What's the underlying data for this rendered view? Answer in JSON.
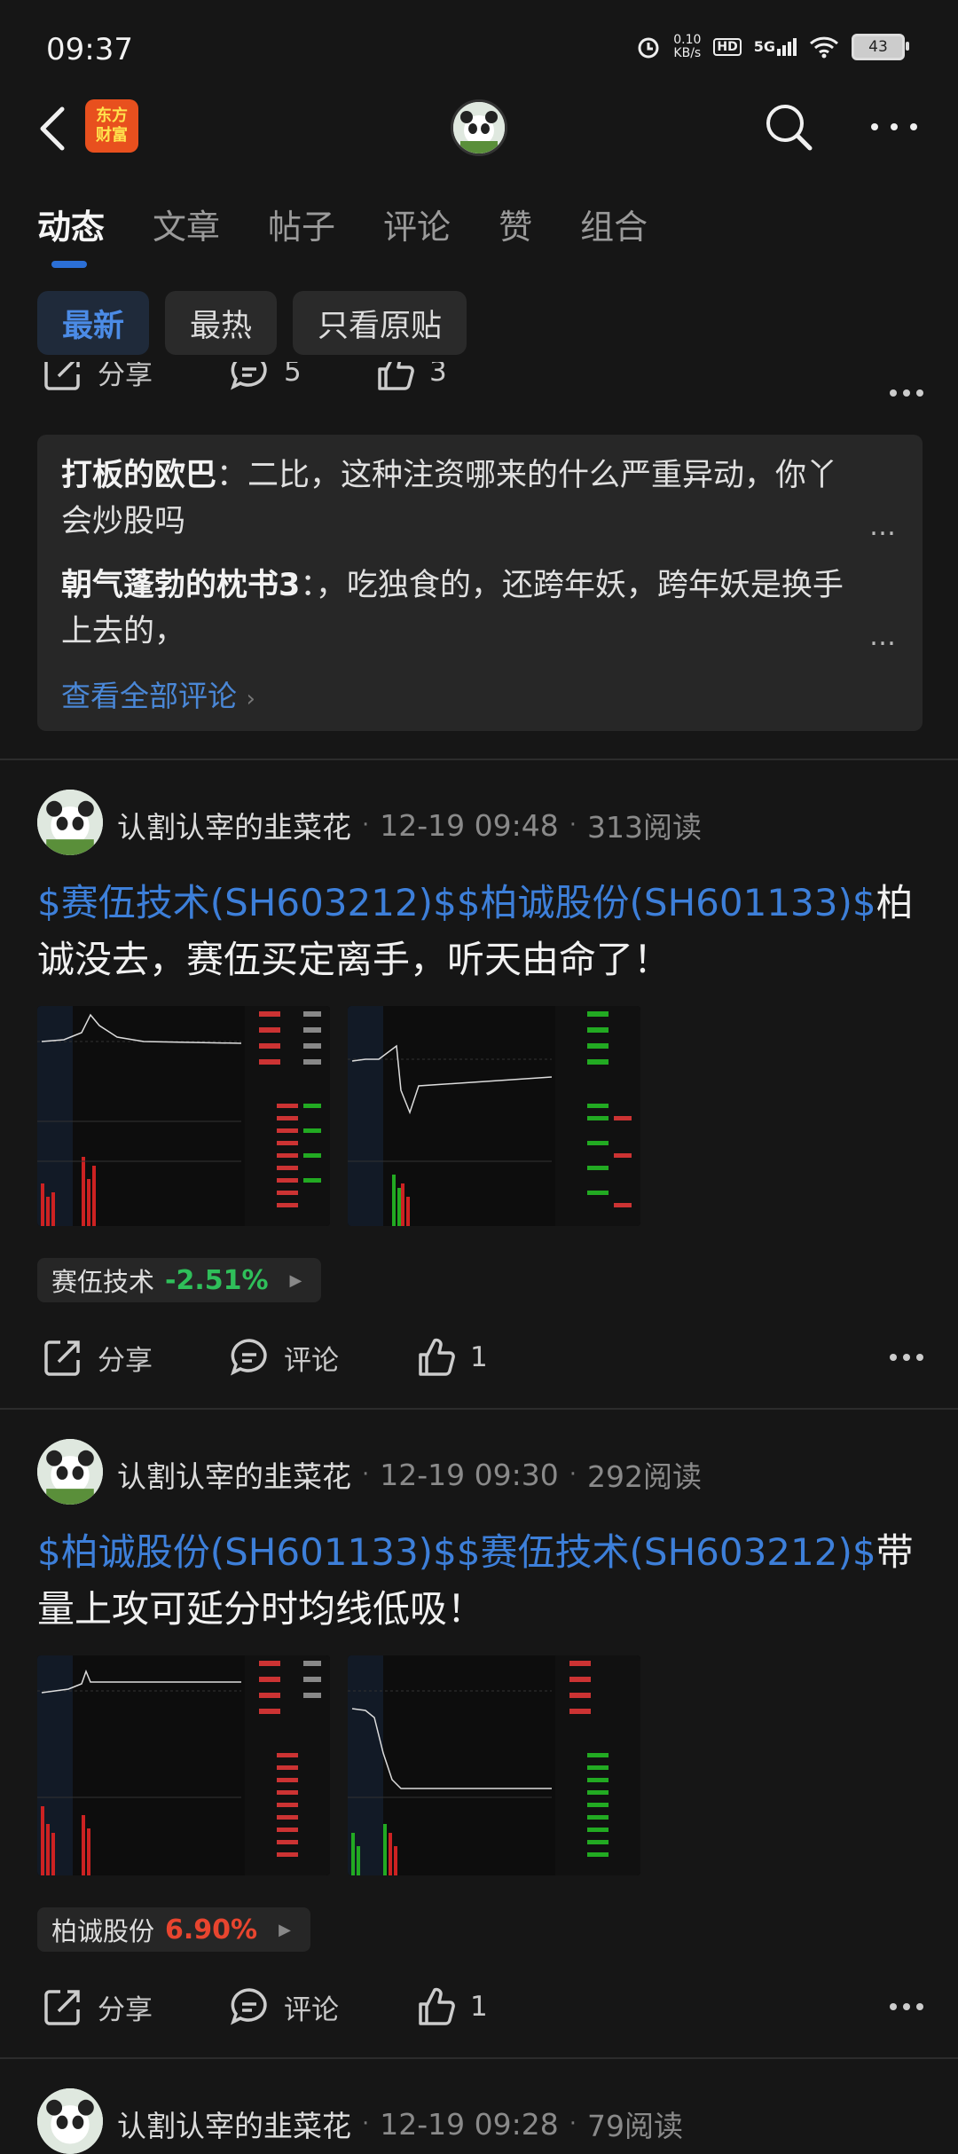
{
  "status": {
    "time": "09:37",
    "net_speed_value": "0.10",
    "net_speed_unit": "KB/s",
    "hd": "HD",
    "signal": "5G",
    "battery": "43"
  },
  "header": {
    "logo_line1": "东方",
    "logo_line2": "财富"
  },
  "tabs": [
    {
      "label": "动态",
      "active": true
    },
    {
      "label": "文章"
    },
    {
      "label": "帖子"
    },
    {
      "label": "评论"
    },
    {
      "label": "赞"
    },
    {
      "label": "组合"
    }
  ],
  "filters": [
    {
      "label": "最新",
      "active": true
    },
    {
      "label": "最热"
    },
    {
      "label": "只看原贴"
    }
  ],
  "prev_post": {
    "share_label": "分享",
    "comment_count": "5",
    "like_count": "3",
    "comments": [
      {
        "author": "打板的欧巴",
        "text": "：二比，这种注资哪来的什么严重异动，你丫会炒股吗"
      },
      {
        "author": "朝气蓬勃的枕书3",
        "text": "：，吃独食的，还跨年妖，跨年妖是换手上去的，"
      }
    ],
    "view_all": "查看全部评论"
  },
  "posts": [
    {
      "author": "认割认宰的韭菜花",
      "time": "12-19 09:48",
      "reads": "313阅读",
      "tag1": "$赛伍技术(SH603212)$",
      "tag2": "$柏诚股份(SH601133)$",
      "text": "柏诚没去，赛伍买定离手，听天由命了！",
      "stock_name": "赛伍技术",
      "stock_change": "-2.51%",
      "stock_color": "#2fbf5a",
      "share_label": "分享",
      "comment_label": "评论",
      "like_count": "1"
    },
    {
      "author": "认割认宰的韭菜花",
      "time": "12-19 09:30",
      "reads": "292阅读",
      "tag1": "$柏诚股份(SH601133)$",
      "tag2": "$赛伍技术(SH603212)$",
      "text": "带量上攻可延分时均线低吸！",
      "stock_name": "柏诚股份",
      "stock_change": "6.90%",
      "stock_color": "#e8452f",
      "share_label": "分享",
      "comment_label": "评论",
      "like_count": "1"
    },
    {
      "author": "认割认宰的韭菜花",
      "time": "12-19 09:28",
      "reads": "79阅读"
    }
  ],
  "colors": {
    "accent": "#2b6fd6",
    "tag": "#3d7fd9",
    "up": "#e8452f",
    "down": "#2fbf5a"
  }
}
